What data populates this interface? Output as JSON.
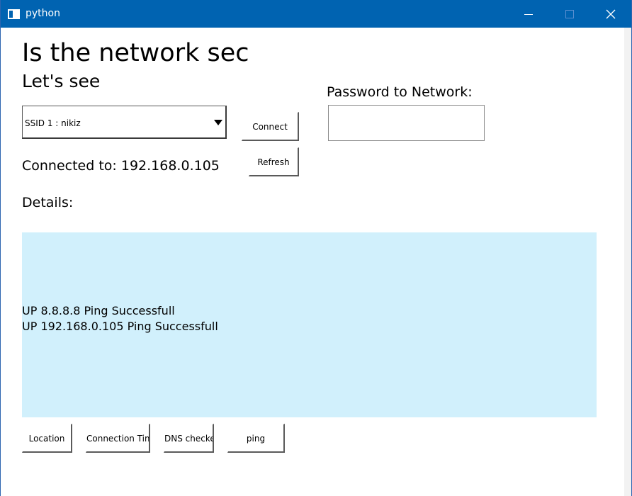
{
  "window": {
    "title": "python",
    "icon": "window-app-icon",
    "controls": {
      "minimize": "minimize-icon",
      "maximize": "maximize-icon",
      "close": "close-icon"
    },
    "titlebar_color": "#0063b1"
  },
  "main": {
    "heading": "Is the network sec",
    "subheading": "Let's see",
    "ssid_select": {
      "selected": "SSID 1 : nikiz"
    },
    "connect_label": "Connect",
    "refresh_label": "Refresh",
    "password_label": "Password to Network:",
    "password_value": "",
    "connected_text": "Connected to: 192.168.0.105",
    "details_label": "Details:",
    "details_lines": [
      "UP 8.8.8.8 Ping Successfull",
      "UP 192.168.0.105 Ping Successfull"
    ],
    "details_bg": "#d1f0fc"
  },
  "bottom_buttons": {
    "location": "Location",
    "connection_time": "Connection Time",
    "dns_checker": "DNS checker",
    "ping": "ping"
  }
}
